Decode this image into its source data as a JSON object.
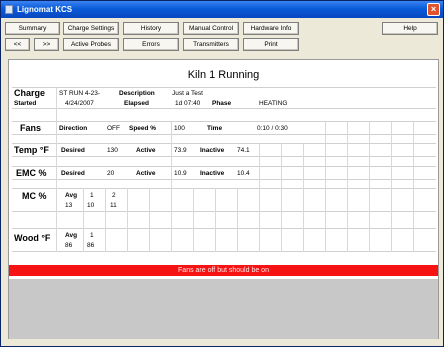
{
  "window": {
    "title": "Lignomat KCS",
    "close_glyph": "×"
  },
  "toolbar": {
    "row1": [
      "Summary",
      "Charge Settings",
      "History",
      "Manual Control",
      "Hardware Info"
    ],
    "row2": [
      "<<",
      ">>",
      "Active Probes",
      "Errors",
      "Transmitters",
      "Print"
    ],
    "help": "Help"
  },
  "main": {
    "heading": "Kiln 1 Running",
    "charge": {
      "label": "Charge",
      "charge_value": "ST RUN 4-23-",
      "description_label": "Description",
      "description_value": "Just a Test",
      "started_label": "Started",
      "started_value": "4/24/2007",
      "elapsed_label": "Elapsed",
      "elapsed_value": "1d 07:40",
      "phase_label": "Phase",
      "phase_value": "HEATING"
    },
    "fans": {
      "label": "Fans",
      "direction_label": "Direction",
      "direction_value": "OFF",
      "speed_label": "Speed %",
      "speed_value": "100",
      "time_label": "Time",
      "time_value": "0:10 / 0:30"
    },
    "temp": {
      "label": "Temp °F",
      "desired_label": "Desired",
      "desired_value": "130",
      "active_label": "Active",
      "active_value": "73.9",
      "inactive_label": "Inactive",
      "inactive_value": "74.1"
    },
    "emc": {
      "label": "EMC %",
      "desired_label": "Desired",
      "desired_value": "20",
      "active_label": "Active",
      "active_value": "10.9",
      "inactive_label": "Inactive",
      "inactive_value": "10.4"
    },
    "mc": {
      "label": "MC %",
      "avg_label": "Avg",
      "headers": [
        "1",
        "2"
      ],
      "values": [
        "13",
        "10",
        "11"
      ]
    },
    "wood": {
      "label": "Wood °F",
      "avg_label": "Avg",
      "headers": [
        "1"
      ],
      "values": [
        "86",
        "86"
      ]
    },
    "alert": "Fans are off but should be on"
  }
}
